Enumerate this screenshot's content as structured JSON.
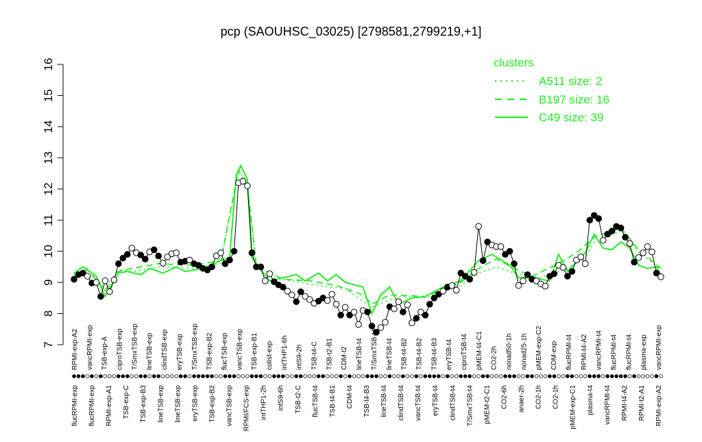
{
  "chart_data": {
    "type": "line",
    "title": "pcp (SAOUHSC_03025) [2798581,2799219,+1]",
    "ylim": [
      7,
      16
    ],
    "y_ticks": [
      7,
      8,
      9,
      10,
      11,
      12,
      13,
      14,
      15,
      16
    ],
    "grid": false,
    "legend_position": "top-right",
    "legend": {
      "title": "clusters",
      "entries": [
        {
          "label": "A511 size: 2",
          "style": "dotted"
        },
        {
          "label": "B197 size: 16",
          "style": "dashed"
        },
        {
          "label": "C49 size: 39",
          "style": "solid"
        }
      ]
    },
    "x_labels_top": [
      "RPMI-exp-A2",
      "vancRPMI-exp",
      "TSB-exp-A",
      "ciproTSB-exp",
      "T/SmxTSB-exp",
      "lineTSB-exp",
      "clindTSB-exp",
      "eryTSB-exp",
      "T/SmxTSB-exp",
      "TSB-exp-B2",
      "flucTSB-exp",
      "vancTSB-exp",
      "TSB-exp-B1",
      "colist-exp",
      "intTHP1-6h",
      "intS9-2h",
      "TSB-t4-C",
      "TSB-t2-B1",
      "CDM-t2",
      "lineTSB-t4",
      "T/SmxTSB-t4",
      "lineTSB-t4",
      "TSB-t4-B2",
      "TSB-t4-B2",
      "TSB-t4-B3",
      "eryTSB-t4",
      "ciproTSB-t4",
      "pMEM-t4-C1",
      "CO2-2h",
      "nonad50-1h",
      "nonad25-1h",
      "pMEM-exp-C2",
      "CDM-exp",
      "flucRPMI-t4",
      "RPMI-t4-A2",
      "vancRPMI-t4",
      "flucRPMI-t4",
      "flucRPMI-t4",
      "plasma-exp",
      "vancRPMI-exp"
    ],
    "x_labels_bottom": [
      "flucRPMI-exp",
      "flucRPMI-exp",
      "RPMI-exp-A1",
      "TSB-exp-C",
      "TSB-exp-B3",
      "lineTSB-exp",
      "lineTSB-exp",
      "eryTSB-exp",
      "TSB-exp-B2",
      "vancTSB-exp",
      "RPMI/FCS-exp",
      "intTHP1-2h",
      "intS9-6h",
      "TSB-t2-C",
      "flucTSB-t4",
      "TSB-t4-B1",
      "CDM-t4",
      "TSB-t4-B3",
      "lineTSB-t4",
      "clindTSB-t4",
      "vancTSB-t4",
      "eryTSB-t4",
      "clindTSB-t4",
      "T/SmxTSB-t4",
      "pMEM-t2-C1",
      "CO2-6h",
      "anaer-2h",
      "CO2-1h",
      "CO2-1h",
      "pMEM-exp-C1",
      "plasma-t4",
      "vancRPMI-t4",
      "RPMI-t4-A2",
      "RPMI-t2-A1",
      "RPMI-exp-A2"
    ],
    "points": [
      {
        "x": 1,
        "y": 9.1,
        "f": 1
      },
      {
        "x": 2,
        "y": 9.25,
        "f": 1
      },
      {
        "x": 3,
        "y": 9.3,
        "f": 1
      },
      {
        "x": 4,
        "y": 9.2,
        "f": 0
      },
      {
        "x": 5,
        "y": 8.98,
        "f": 1
      },
      {
        "x": 6,
        "y": 9.0,
        "f": 0
      },
      {
        "x": 7,
        "y": 8.55,
        "f": 1
      },
      {
        "x": 8,
        "y": 9.05,
        "f": 0
      },
      {
        "x": 9,
        "y": 8.7,
        "f": 0
      },
      {
        "x": 10,
        "y": 9.08,
        "f": 0
      },
      {
        "x": 11,
        "y": 9.6,
        "f": 1
      },
      {
        "x": 12,
        "y": 9.78,
        "f": 1
      },
      {
        "x": 13,
        "y": 9.9,
        "f": 1
      },
      {
        "x": 14,
        "y": 10.1,
        "f": 0
      },
      {
        "x": 15,
        "y": 9.95,
        "f": 0
      },
      {
        "x": 16,
        "y": 9.88,
        "f": 1
      },
      {
        "x": 17,
        "y": 9.75,
        "f": 1
      },
      {
        "x": 18,
        "y": 9.98,
        "f": 0
      },
      {
        "x": 19,
        "y": 10.05,
        "f": 1
      },
      {
        "x": 20,
        "y": 9.85,
        "f": 1
      },
      {
        "x": 21,
        "y": 9.62,
        "f": 0
      },
      {
        "x": 22,
        "y": 9.82,
        "f": 0
      },
      {
        "x": 23,
        "y": 9.92,
        "f": 0
      },
      {
        "x": 24,
        "y": 9.95,
        "f": 0
      },
      {
        "x": 25,
        "y": 9.65,
        "f": 1
      },
      {
        "x": 26,
        "y": 9.68,
        "f": 1
      },
      {
        "x": 27,
        "y": 9.72,
        "f": 0
      },
      {
        "x": 28,
        "y": 9.6,
        "f": 1
      },
      {
        "x": 29,
        "y": 9.55,
        "f": 1
      },
      {
        "x": 30,
        "y": 9.45,
        "f": 1
      },
      {
        "x": 31,
        "y": 9.4,
        "f": 1
      },
      {
        "x": 32,
        "y": 9.5,
        "f": 1
      },
      {
        "x": 33,
        "y": 9.85,
        "f": 0
      },
      {
        "x": 34,
        "y": 9.95,
        "f": 0
      },
      {
        "x": 35,
        "y": 9.6,
        "f": 1
      },
      {
        "x": 36,
        "y": 9.72,
        "f": 1
      },
      {
        "x": 37,
        "y": 10.0,
        "f": 1
      },
      {
        "x": 38,
        "y": 12.2,
        "f": 0
      },
      {
        "x": 39,
        "y": 12.25,
        "f": 0
      },
      {
        "x": 40,
        "y": 12.1,
        "f": 0
      },
      {
        "x": 41,
        "y": 9.95,
        "f": 1
      },
      {
        "x": 42,
        "y": 9.5,
        "f": 1
      },
      {
        "x": 43,
        "y": 9.5,
        "f": 1
      },
      {
        "x": 44,
        "y": 9.05,
        "f": 0
      },
      {
        "x": 45,
        "y": 9.28,
        "f": 0
      },
      {
        "x": 46,
        "y": 9.02,
        "f": 1
      },
      {
        "x": 47,
        "y": 8.92,
        "f": 1
      },
      {
        "x": 48,
        "y": 8.85,
        "f": 1
      },
      {
        "x": 49,
        "y": 8.72,
        "f": 0
      },
      {
        "x": 50,
        "y": 8.6,
        "f": 0
      },
      {
        "x": 51,
        "y": 8.38,
        "f": 1
      },
      {
        "x": 52,
        "y": 8.7,
        "f": 1
      },
      {
        "x": 53,
        "y": 8.55,
        "f": 0
      },
      {
        "x": 54,
        "y": 8.45,
        "f": 0
      },
      {
        "x": 55,
        "y": 8.33,
        "f": 0
      },
      {
        "x": 56,
        "y": 8.4,
        "f": 1
      },
      {
        "x": 57,
        "y": 8.5,
        "f": 1
      },
      {
        "x": 58,
        "y": 8.42,
        "f": 0
      },
      {
        "x": 59,
        "y": 8.62,
        "f": 0
      },
      {
        "x": 60,
        "y": 8.3,
        "f": 0
      },
      {
        "x": 61,
        "y": 7.95,
        "f": 1
      },
      {
        "x": 62,
        "y": 8.2,
        "f": 0
      },
      {
        "x": 63,
        "y": 7.95,
        "f": 1
      },
      {
        "x": 64,
        "y": 8.05,
        "f": 0
      },
      {
        "x": 65,
        "y": 7.65,
        "f": 0
      },
      {
        "x": 66,
        "y": 8.1,
        "f": 0
      },
      {
        "x": 67,
        "y": 8.05,
        "f": 1
      },
      {
        "x": 68,
        "y": 7.6,
        "f": 1
      },
      {
        "x": 69,
        "y": 7.4,
        "f": 1
      },
      {
        "x": 70,
        "y": 7.55,
        "f": 0
      },
      {
        "x": 71,
        "y": 7.72,
        "f": 0
      },
      {
        "x": 72,
        "y": 8.22,
        "f": 1
      },
      {
        "x": 73,
        "y": 8.15,
        "f": 0
      },
      {
        "x": 74,
        "y": 8.38,
        "f": 0
      },
      {
        "x": 75,
        "y": 8.05,
        "f": 1
      },
      {
        "x": 76,
        "y": 8.28,
        "f": 0
      },
      {
        "x": 77,
        "y": 7.7,
        "f": 0
      },
      {
        "x": 78,
        "y": 7.85,
        "f": 1
      },
      {
        "x": 79,
        "y": 8.05,
        "f": 0
      },
      {
        "x": 80,
        "y": 7.95,
        "f": 1
      },
      {
        "x": 81,
        "y": 8.3,
        "f": 1
      },
      {
        "x": 82,
        "y": 8.5,
        "f": 1
      },
      {
        "x": 83,
        "y": 8.62,
        "f": 1
      },
      {
        "x": 84,
        "y": 8.72,
        "f": 0
      },
      {
        "x": 85,
        "y": 8.85,
        "f": 1
      },
      {
        "x": 86,
        "y": 8.9,
        "f": 0
      },
      {
        "x": 87,
        "y": 8.75,
        "f": 0
      },
      {
        "x": 88,
        "y": 9.3,
        "f": 1
      },
      {
        "x": 89,
        "y": 9.2,
        "f": 1
      },
      {
        "x": 90,
        "y": 9.1,
        "f": 1
      },
      {
        "x": 91,
        "y": 9.32,
        "f": 0
      },
      {
        "x": 92,
        "y": 10.8,
        "f": 0
      },
      {
        "x": 93,
        "y": 9.7,
        "f": 1
      },
      {
        "x": 94,
        "y": 10.3,
        "f": 1
      },
      {
        "x": 95,
        "y": 10.2,
        "f": 0
      },
      {
        "x": 96,
        "y": 10.15,
        "f": 0
      },
      {
        "x": 97,
        "y": 10.15,
        "f": 0
      },
      {
        "x": 98,
        "y": 9.9,
        "f": 1
      },
      {
        "x": 99,
        "y": 10.0,
        "f": 1
      },
      {
        "x": 100,
        "y": 9.6,
        "f": 1
      },
      {
        "x": 101,
        "y": 8.9,
        "f": 0
      },
      {
        "x": 102,
        "y": 9.05,
        "f": 0
      },
      {
        "x": 103,
        "y": 9.25,
        "f": 1
      },
      {
        "x": 104,
        "y": 9.1,
        "f": 1
      },
      {
        "x": 105,
        "y": 9.05,
        "f": 0
      },
      {
        "x": 106,
        "y": 8.95,
        "f": 0
      },
      {
        "x": 107,
        "y": 8.88,
        "f": 0
      },
      {
        "x": 108,
        "y": 9.2,
        "f": 1
      },
      {
        "x": 109,
        "y": 9.28,
        "f": 1
      },
      {
        "x": 110,
        "y": 9.55,
        "f": 0
      },
      {
        "x": 111,
        "y": 9.48,
        "f": 0
      },
      {
        "x": 112,
        "y": 9.2,
        "f": 1
      },
      {
        "x": 113,
        "y": 9.35,
        "f": 1
      },
      {
        "x": 114,
        "y": 9.72,
        "f": 0
      },
      {
        "x": 115,
        "y": 9.82,
        "f": 0
      },
      {
        "x": 116,
        "y": 9.6,
        "f": 0
      },
      {
        "x": 117,
        "y": 11.0,
        "f": 1
      },
      {
        "x": 118,
        "y": 11.15,
        "f": 1
      },
      {
        "x": 119,
        "y": 11.05,
        "f": 1
      },
      {
        "x": 120,
        "y": 10.35,
        "f": 0
      },
      {
        "x": 121,
        "y": 10.55,
        "f": 1
      },
      {
        "x": 122,
        "y": 10.65,
        "f": 1
      },
      {
        "x": 123,
        "y": 10.8,
        "f": 1
      },
      {
        "x": 124,
        "y": 10.75,
        "f": 1
      },
      {
        "x": 125,
        "y": 10.45,
        "f": 1
      },
      {
        "x": 126,
        "y": 10.25,
        "f": 0
      },
      {
        "x": 127,
        "y": 9.65,
        "f": 1
      },
      {
        "x": 128,
        "y": 9.8,
        "f": 0
      },
      {
        "x": 129,
        "y": 9.95,
        "f": 0
      },
      {
        "x": 130,
        "y": 10.15,
        "f": 0
      },
      {
        "x": 131,
        "y": 9.98,
        "f": 0
      },
      {
        "x": 132,
        "y": 9.3,
        "f": 1
      },
      {
        "x": 133,
        "y": 9.18,
        "f": 0
      }
    ],
    "cluster_lines": [
      {
        "name": "A511 size: 2",
        "style": "dotted",
        "values": [
          [
            1,
            9.2
          ],
          [
            4,
            9.45
          ],
          [
            8,
            8.7
          ],
          [
            11,
            9.4
          ],
          [
            14,
            9.35
          ],
          [
            20,
            9.5
          ],
          [
            28,
            9.45
          ],
          [
            34,
            9.6
          ],
          [
            38,
            12.6
          ],
          [
            40,
            12.2
          ],
          [
            42,
            9.5
          ],
          [
            48,
            9.1
          ],
          [
            56,
            8.9
          ],
          [
            62,
            8.8
          ],
          [
            68,
            8.2
          ],
          [
            74,
            8.55
          ],
          [
            80,
            8.5
          ],
          [
            88,
            8.9
          ],
          [
            92,
            9.3
          ],
          [
            96,
            9.5
          ],
          [
            100,
            9.3
          ],
          [
            106,
            9.15
          ],
          [
            112,
            9.45
          ],
          [
            116,
            9.8
          ],
          [
            118,
            10.3
          ],
          [
            124,
            10.65
          ],
          [
            128,
            10.0
          ],
          [
            133,
            9.4
          ]
        ]
      },
      {
        "name": "B197 size: 16",
        "style": "dashed",
        "values": [
          [
            1,
            9.25
          ],
          [
            4,
            9.4
          ],
          [
            8,
            8.75
          ],
          [
            11,
            9.35
          ],
          [
            14,
            9.45
          ],
          [
            20,
            9.6
          ],
          [
            28,
            9.55
          ],
          [
            34,
            9.7
          ],
          [
            38,
            12.6
          ],
          [
            40,
            12.1
          ],
          [
            42,
            9.55
          ],
          [
            48,
            9.1
          ],
          [
            54,
            9.05
          ],
          [
            60,
            8.9
          ],
          [
            66,
            8.6
          ],
          [
            68,
            8.3
          ],
          [
            72,
            8.6
          ],
          [
            80,
            8.55
          ],
          [
            88,
            9.0
          ],
          [
            92,
            9.45
          ],
          [
            96,
            9.75
          ],
          [
            100,
            9.45
          ],
          [
            104,
            9.2
          ],
          [
            110,
            9.6
          ],
          [
            114,
            9.95
          ],
          [
            118,
            10.45
          ],
          [
            124,
            10.75
          ],
          [
            128,
            10.05
          ],
          [
            133,
            9.45
          ]
        ]
      },
      {
        "name": "C49 size: 39",
        "style": "solid",
        "values": [
          [
            1,
            9.3
          ],
          [
            3,
            9.5
          ],
          [
            6,
            9.2
          ],
          [
            8,
            8.55
          ],
          [
            11,
            9.3
          ],
          [
            13,
            9.35
          ],
          [
            16,
            9.25
          ],
          [
            18,
            9.45
          ],
          [
            21,
            9.3
          ],
          [
            24,
            9.5
          ],
          [
            26,
            9.35
          ],
          [
            30,
            9.45
          ],
          [
            34,
            9.7
          ],
          [
            36,
            9.8
          ],
          [
            37.5,
            12.45
          ],
          [
            38.5,
            12.75
          ],
          [
            40,
            12.3
          ],
          [
            41,
            9.8
          ],
          [
            43,
            9.4
          ],
          [
            45,
            9.05
          ],
          [
            48,
            9.15
          ],
          [
            51,
            9.25
          ],
          [
            53,
            9.05
          ],
          [
            56,
            9.3
          ],
          [
            58,
            9.05
          ],
          [
            60,
            9.25
          ],
          [
            62,
            9.0
          ],
          [
            66,
            8.85
          ],
          [
            68,
            8.0
          ],
          [
            70,
            8.6
          ],
          [
            72,
            8.85
          ],
          [
            74,
            8.3
          ],
          [
            77,
            8.5
          ],
          [
            80,
            8.55
          ],
          [
            84,
            8.85
          ],
          [
            88,
            9.05
          ],
          [
            92,
            9.7
          ],
          [
            95,
            9.9
          ],
          [
            99,
            9.55
          ],
          [
            101,
            9.15
          ],
          [
            104,
            9.15
          ],
          [
            108,
            9.05
          ],
          [
            110,
            9.9
          ],
          [
            112,
            9.35
          ],
          [
            116,
            9.95
          ],
          [
            118,
            10.55
          ],
          [
            120,
            10.1
          ],
          [
            122,
            10.05
          ],
          [
            124,
            10.3
          ],
          [
            126,
            10.1
          ],
          [
            128,
            9.55
          ],
          [
            130,
            9.45
          ],
          [
            132,
            9.5
          ],
          [
            133,
            9.25
          ]
        ]
      }
    ],
    "colors": {
      "cluster_line": "#22ee22",
      "axis": "#000000",
      "point_filled": "#000000",
      "point_open": "#ffffff"
    }
  }
}
